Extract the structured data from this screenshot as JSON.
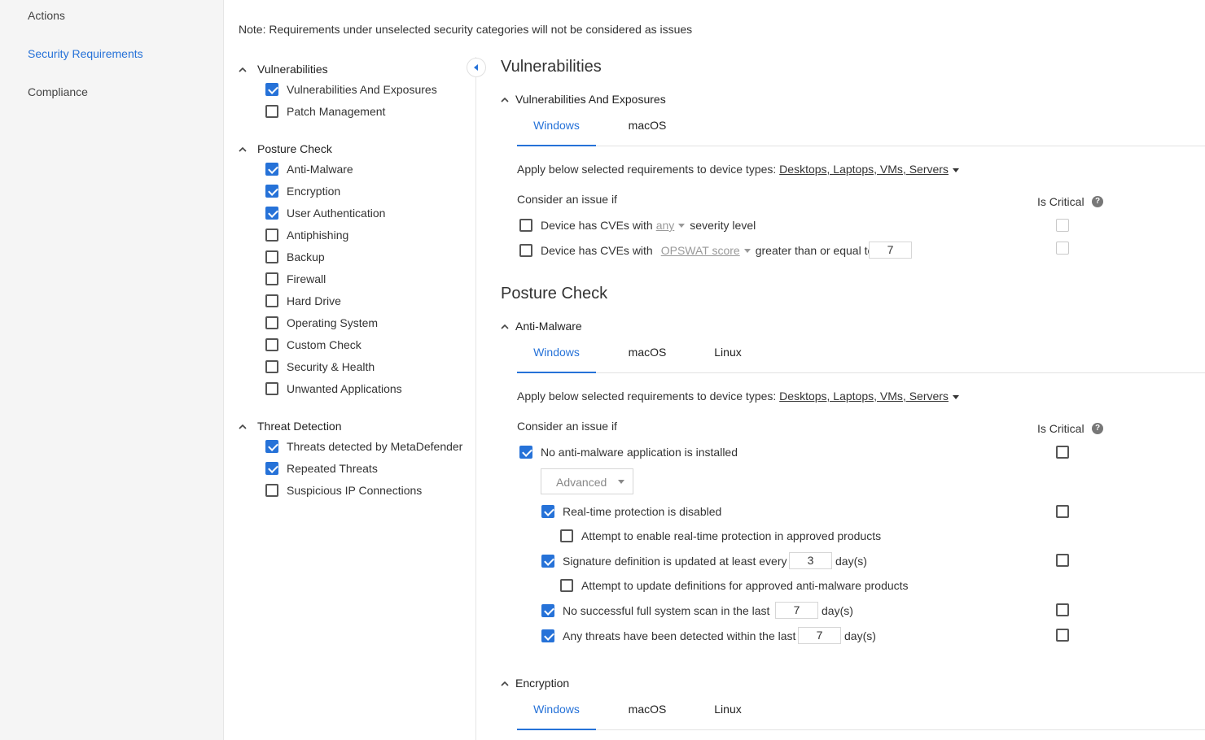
{
  "nav": {
    "items": [
      {
        "label": "Actions",
        "active": false
      },
      {
        "label": "Security Requirements",
        "active": true
      },
      {
        "label": "Compliance",
        "active": false
      }
    ]
  },
  "note": "Note: Requirements under unselected security categories will not be considered as issues",
  "categories": [
    {
      "title": "Vulnerabilities",
      "items": [
        {
          "label": "Vulnerabilities And Exposures",
          "checked": true
        },
        {
          "label": "Patch Management",
          "checked": false
        }
      ]
    },
    {
      "title": "Posture Check",
      "items": [
        {
          "label": "Anti-Malware",
          "checked": true
        },
        {
          "label": "Encryption",
          "checked": true
        },
        {
          "label": "User Authentication",
          "checked": true
        },
        {
          "label": "Antiphishing",
          "checked": false
        },
        {
          "label": "Backup",
          "checked": false
        },
        {
          "label": "Firewall",
          "checked": false
        },
        {
          "label": "Hard Drive",
          "checked": false
        },
        {
          "label": "Operating System",
          "checked": false
        },
        {
          "label": "Custom Check",
          "checked": false
        },
        {
          "label": "Security & Health",
          "checked": false
        },
        {
          "label": "Unwanted Applications",
          "checked": false
        }
      ]
    },
    {
      "title": "Threat Detection",
      "items": [
        {
          "label": "Threats detected by MetaDefender",
          "checked": true
        },
        {
          "label": "Repeated Threats",
          "checked": true
        },
        {
          "label": "Suspicious IP Connections",
          "checked": false
        }
      ]
    }
  ],
  "content": {
    "vuln": {
      "heading": "Vulnerabilities",
      "section_title": "Vulnerabilities And Exposures",
      "tabs": [
        "Windows",
        "macOS"
      ],
      "apply_prefix": "Apply below selected requirements to device types:",
      "device_types": "Desktops, Laptops, VMs, Servers",
      "consider": "Consider an issue if",
      "is_critical": "Is Critical",
      "row1": {
        "prefix": "Device has CVEs with",
        "dropdown": "any",
        "suffix": "severity level",
        "checked": false
      },
      "row2": {
        "prefix": "Device has CVEs with",
        "dropdown": "OPSWAT score",
        "suffix": "greater than or equal to",
        "value": "7",
        "checked": false
      }
    },
    "posture": {
      "heading": "Posture Check",
      "antimalware": {
        "section_title": "Anti-Malware",
        "tabs": [
          "Windows",
          "macOS",
          "Linux"
        ],
        "apply_prefix": "Apply below selected requirements to device types:",
        "device_types": "Desktops, Laptops, VMs, Servers",
        "consider": "Consider an issue if",
        "is_critical": "Is Critical",
        "no_app": "No anti-malware application is installed",
        "mode_select": "Advanced",
        "realtime": "Real-time protection is disabled",
        "realtime_attempt": "Attempt to enable real-time protection in approved products",
        "signature": "Signature definition is updated at least every",
        "signature_value": "3",
        "days": "day(s)",
        "signature_attempt": "Attempt to update definitions for approved anti-malware products",
        "fullscan": "No successful full system scan in the last",
        "fullscan_value": "7",
        "threats": "Any threats have been detected within the last",
        "threats_value": "7"
      },
      "encryption": {
        "section_title": "Encryption",
        "tabs": [
          "Windows",
          "macOS",
          "Linux"
        ]
      }
    }
  }
}
